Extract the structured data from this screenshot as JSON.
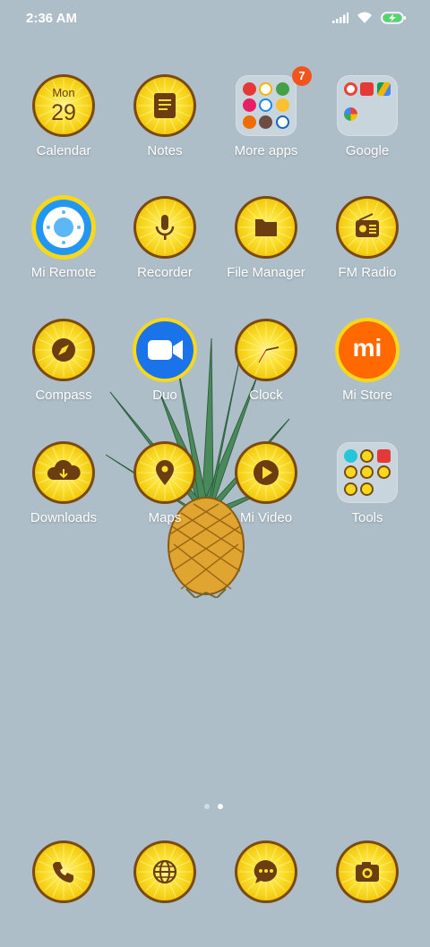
{
  "status_bar": {
    "time": "2:36 AM"
  },
  "apps": [
    {
      "id": "calendar",
      "label": "Calendar",
      "cal_day": "Mon",
      "cal_date": "29"
    },
    {
      "id": "notes",
      "label": "Notes"
    },
    {
      "id": "more-apps",
      "label": "More apps",
      "badge": "7"
    },
    {
      "id": "google",
      "label": "Google"
    },
    {
      "id": "mi-remote",
      "label": "Mi Remote"
    },
    {
      "id": "recorder",
      "label": "Recorder"
    },
    {
      "id": "file-manager",
      "label": "File Manager"
    },
    {
      "id": "fm-radio",
      "label": "FM Radio"
    },
    {
      "id": "compass",
      "label": "Compass"
    },
    {
      "id": "duo",
      "label": "Duo"
    },
    {
      "id": "clock",
      "label": "Clock"
    },
    {
      "id": "mi-store",
      "label": "Mi Store"
    },
    {
      "id": "downloads",
      "label": "Downloads"
    },
    {
      "id": "maps",
      "label": "Maps"
    },
    {
      "id": "mi-video",
      "label": "Mi Video"
    },
    {
      "id": "tools",
      "label": "Tools"
    }
  ],
  "dock": [
    {
      "id": "phone",
      "icon": "phone-icon"
    },
    {
      "id": "browser",
      "icon": "globe-icon"
    },
    {
      "id": "messaging",
      "icon": "chat-icon"
    },
    {
      "id": "camera",
      "icon": "camera-icon"
    }
  ],
  "pager": {
    "pages": 2,
    "current": 2
  },
  "mi_store_logo_text": "mi",
  "colors": {
    "wallpaper": "#aebec8",
    "pineapple_yellow": "#f7d81a",
    "rim": "#7a4a12",
    "glyph": "#6b3d10",
    "badge": "#f2541c"
  }
}
